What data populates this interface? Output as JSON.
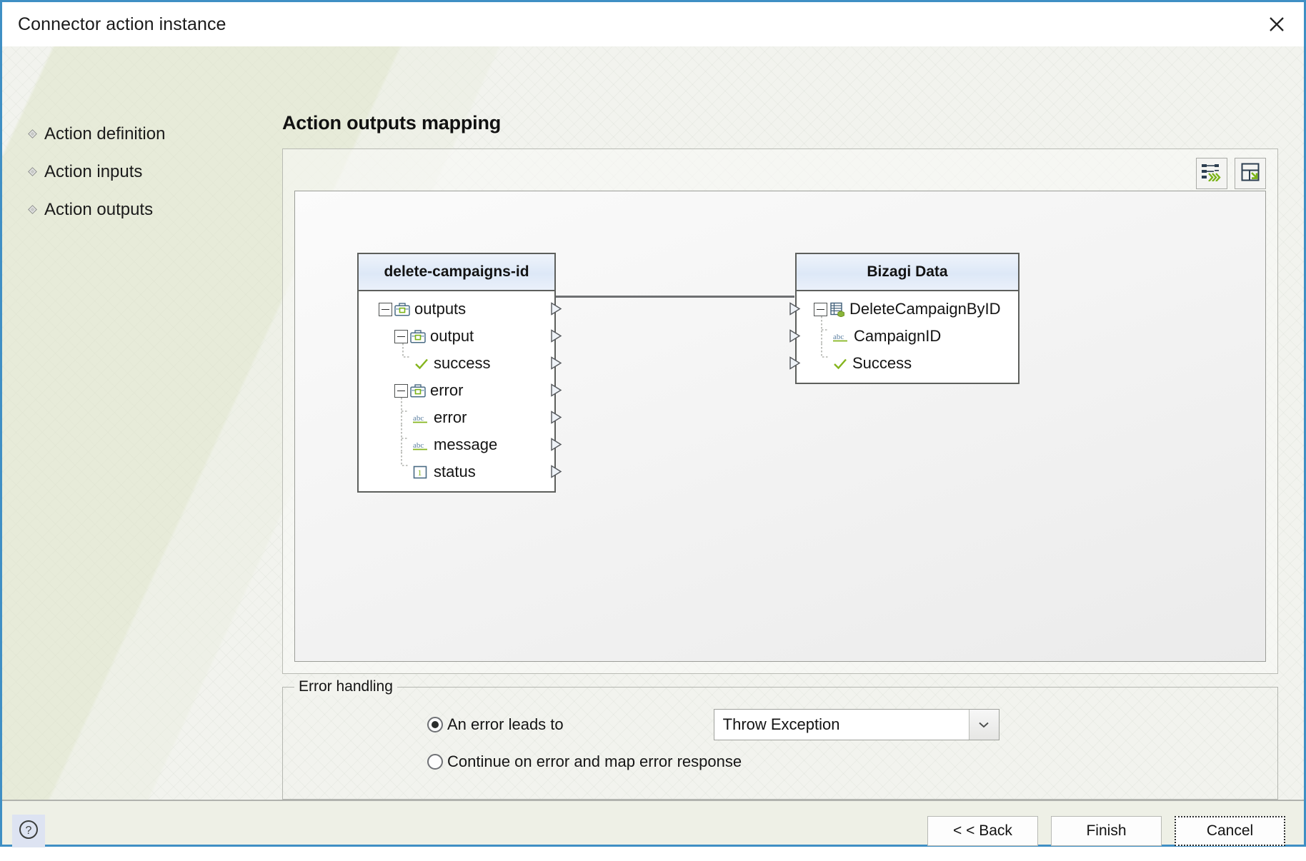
{
  "window": {
    "title": "Connector action instance",
    "close_icon": "close-icon"
  },
  "sidebar": {
    "items": [
      {
        "label": "Action definition",
        "icon": "diamond-bullet-icon"
      },
      {
        "label": "Action inputs",
        "icon": "diamond-bullet-icon"
      },
      {
        "label": "Action outputs",
        "icon": "diamond-bullet-icon"
      }
    ]
  },
  "main": {
    "page_title": "Action outputs mapping",
    "toolbar": {
      "auto_map_label": "auto-map-icon",
      "save_mapping_label": "save-mapping-icon"
    }
  },
  "mapping": {
    "source": {
      "title": "delete-campaigns-id",
      "rows": [
        {
          "label": "outputs",
          "icon": "briefcase-icon",
          "indent": 0,
          "expander": true,
          "tree_connector": "none"
        },
        {
          "label": "output",
          "icon": "briefcase-icon",
          "indent": 1,
          "expander": true,
          "tree_connector": "none"
        },
        {
          "label": "success",
          "icon": "check-icon",
          "indent": 2,
          "expander": false,
          "tree_connector": "last"
        },
        {
          "label": "error",
          "icon": "briefcase-icon",
          "indent": 1,
          "expander": true,
          "tree_connector": "none"
        },
        {
          "label": "error",
          "icon": "abc-icon",
          "indent": 2,
          "expander": false,
          "tree_connector": "mid"
        },
        {
          "label": "message",
          "icon": "abc-icon",
          "indent": 2,
          "expander": false,
          "tree_connector": "mid"
        },
        {
          "label": "status",
          "icon": "number-icon",
          "indent": 2,
          "expander": false,
          "tree_connector": "last"
        }
      ]
    },
    "target": {
      "title": "Bizagi Data",
      "rows": [
        {
          "label": "DeleteCampaignByID",
          "icon": "entity-icon",
          "indent": 0,
          "expander": true,
          "tree_connector": "none"
        },
        {
          "label": "CampaignID",
          "icon": "abc-icon",
          "indent": 1,
          "expander": false,
          "tree_connector": "mid"
        },
        {
          "label": "Success",
          "icon": "check-icon",
          "indent": 1,
          "expander": false,
          "tree_connector": "last"
        }
      ]
    },
    "connection": {
      "from": "success",
      "to": "Success"
    }
  },
  "error_handling": {
    "group_title": "Error handling",
    "option_error_leads_to": "An error leads to",
    "option_continue": "Continue on error and map error response",
    "selected_option": "An error leads to",
    "dropdown_value": "Throw Exception",
    "dropdown_icon": "chevron-down-icon"
  },
  "footer": {
    "help_icon": "question-mark-icon",
    "back_label": "< < Back",
    "finish_label": "Finish",
    "cancel_label": "Cancel"
  }
}
